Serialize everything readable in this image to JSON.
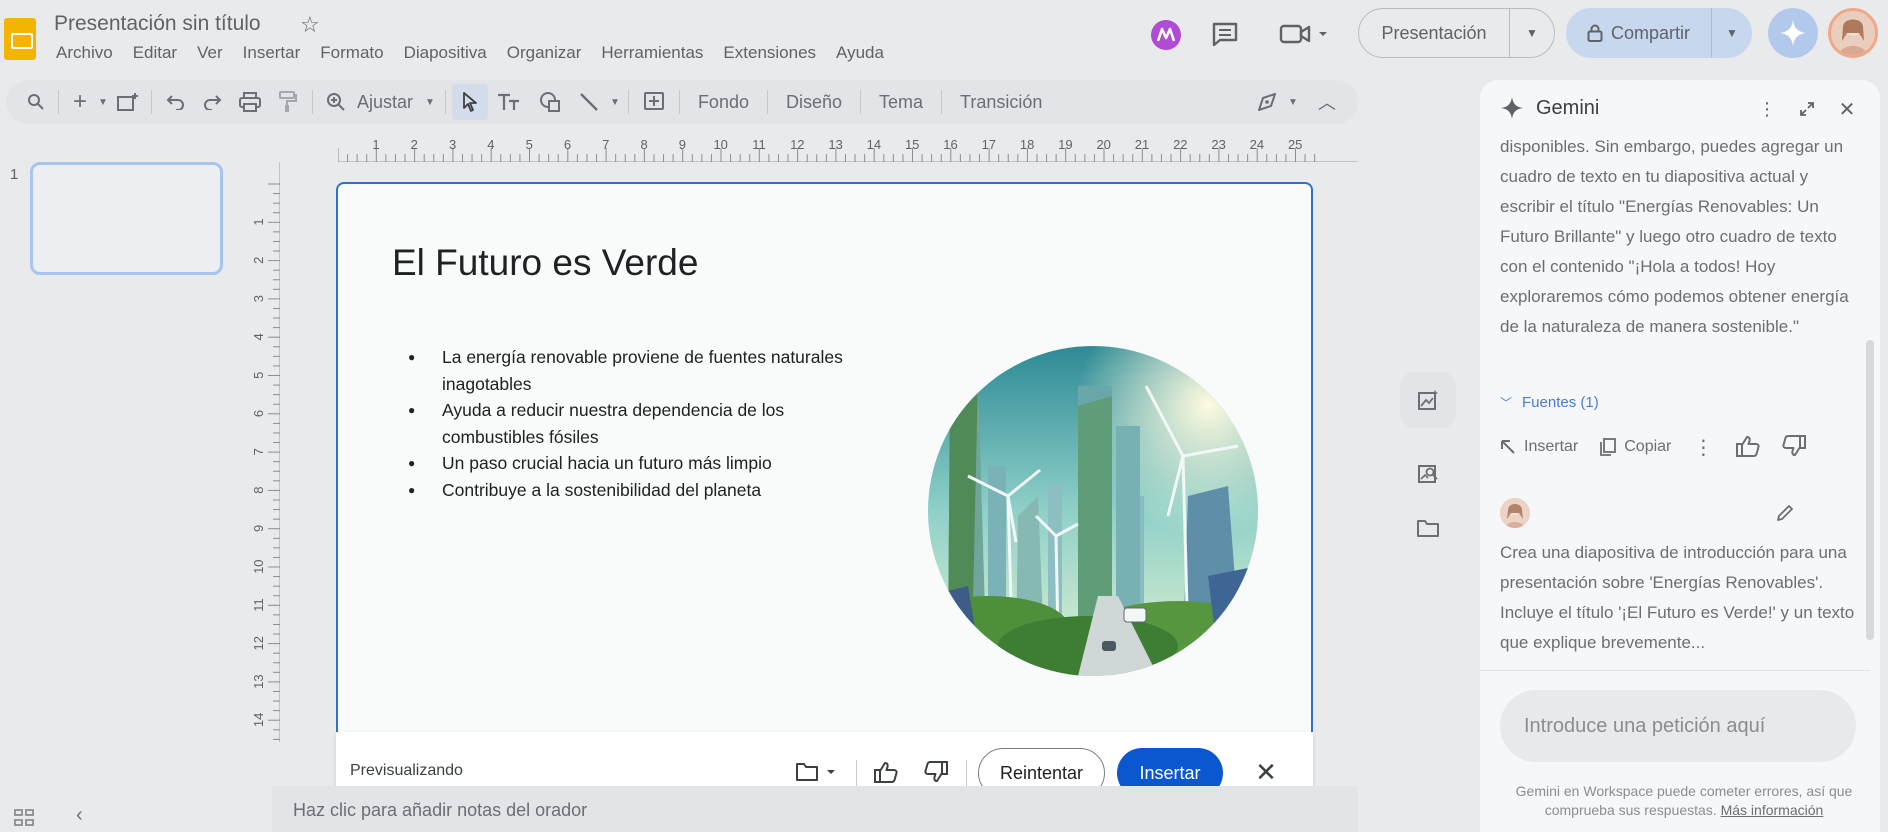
{
  "app": {
    "doc_title": "Presentación sin título",
    "menu": [
      "Archivo",
      "Editar",
      "Ver",
      "Insertar",
      "Formato",
      "Diapositiva",
      "Organizar",
      "Herramientas",
      "Extensiones",
      "Ayuda"
    ],
    "present_label": "Presentación",
    "share_label": "Compartir"
  },
  "toolbar": {
    "zoom_label": "Ajustar",
    "background_label": "Fondo",
    "layout_label": "Diseño",
    "theme_label": "Tema",
    "transition_label": "Transición"
  },
  "filmstrip": {
    "slide_number": "1"
  },
  "ruler": {
    "horizontal": [
      "1",
      "2",
      "3",
      "4",
      "5",
      "6",
      "7",
      "8",
      "9",
      "10",
      "11",
      "12",
      "13",
      "14",
      "15",
      "16",
      "17",
      "18",
      "19",
      "20",
      "21",
      "22",
      "23",
      "24",
      "25"
    ],
    "vertical": [
      "1",
      "2",
      "3",
      "4",
      "5",
      "6",
      "7",
      "8",
      "9",
      "10",
      "11",
      "12",
      "13",
      "14"
    ]
  },
  "slide": {
    "title": "El Futuro es Verde",
    "bullets": [
      "La energía renovable proviene de fuentes naturales inagotables",
      "Ayuda a reducir nuestra dependencia de los combustibles fósiles",
      "Un paso crucial hacia un futuro más limpio",
      "Contribuye a la sostenibilidad del planeta"
    ]
  },
  "preview": {
    "label": "Previsualizando",
    "retry_label": "Reintentar",
    "insert_label": "Insertar"
  },
  "notes": {
    "placeholder": "Haz clic para añadir notas del orador"
  },
  "gemini": {
    "title": "Gemini",
    "response_text": "disponibles. Sin embargo, puedes agregar un cuadro de texto en tu diapositiva actual y escribir el título \"Energías Renovables: Un Futuro Brillante\" y luego otro cuadro de texto con el contenido \"¡Hola a todos! Hoy exploraremos cómo podemos obtener energía de la naturaleza de manera sostenible.\"",
    "sources_label": "Fuentes (1)",
    "insert_label": "Insertar",
    "copy_label": "Copiar",
    "user_prompt": "Crea una diapositiva de introducción para una presentación sobre 'Energías Renovables'. Incluye el título '¡El Futuro es Verde!' y un texto que explique brevemente...",
    "input_placeholder": "Introduce una petición aquí",
    "disclaimer": "Gemini en Workspace puede cometer errores, así que comprueba sus respuestas.",
    "learn_more": "Más información"
  }
}
